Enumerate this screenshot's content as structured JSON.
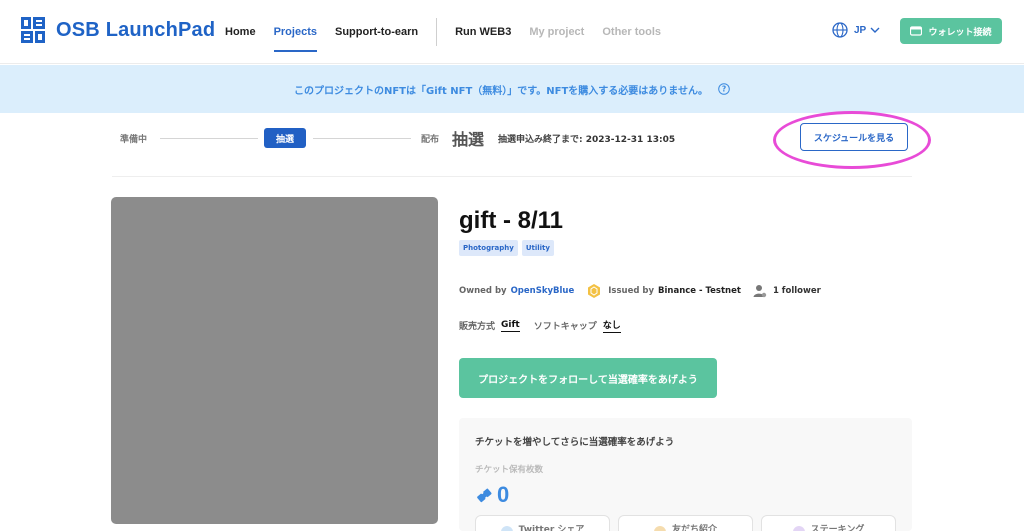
{
  "header": {
    "brand": "OSB LaunchPad",
    "nav": [
      {
        "label": "Home"
      },
      {
        "label": "Projects"
      },
      {
        "label": "Support-to-earn"
      },
      {
        "label": "Run WEB3"
      },
      {
        "label": "My project"
      },
      {
        "label": "Other tools"
      }
    ],
    "language": "JP",
    "wallet_button": "ウォレット接続"
  },
  "notice": {
    "text": "このプロジェクトのNFTは「Gift NFT（無料）」です。NFTを購入する必要はありません。"
  },
  "progress": {
    "steps": [
      "準備中",
      "抽選",
      "配布"
    ],
    "current": "抽選",
    "deadline_label": "抽選申込み終了まで:",
    "deadline_value": "2023-12-31 13:05",
    "schedule_button": "スケジュールを見る"
  },
  "project": {
    "title": "gift - 8/11",
    "tags": [
      "Photography",
      "Utility"
    ],
    "owned_by_label": "Owned by",
    "owner": "OpenSkyBlue",
    "issued_by_label": "Issued by",
    "chain": "Binance - Testnet",
    "followers": "1 follower",
    "sale_method_label": "販売方式",
    "sale_method": "Gift",
    "soft_cap_label": "ソフトキャップ",
    "soft_cap": "なし",
    "follow_button": "プロジェクトをフォローして当選確率をあげよう"
  },
  "tickets": {
    "heading": "チケットを増やしてさらに当選確率をあげよう",
    "owned_label": "チケット保有枚数",
    "count": "0",
    "actions": [
      {
        "label": "Twitter シェア"
      },
      {
        "label": "友だち紹介"
      },
      {
        "label": "ステーキング"
      }
    ]
  },
  "colors": {
    "brand_blue": "#2a67c7",
    "green": "#5bc49f",
    "notice_bg": "#dbeefc",
    "highlight": "#e84bd7"
  }
}
